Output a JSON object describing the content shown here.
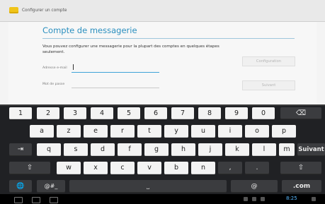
{
  "appbar": {
    "title": "Configurer un compte"
  },
  "page": {
    "title": "Compte de messagerie",
    "description": "Vous pouvez configurer une messagerie pour la plupart des comptes en quelques étapes seulement.",
    "email_label": "Adresse e-mail",
    "password_label": "Mot de passe",
    "config_button": "Configuration",
    "next_button": "Suivant"
  },
  "keyboard": {
    "row1": [
      "1",
      "2",
      "3",
      "4",
      "5",
      "6",
      "7",
      "8",
      "9",
      "0"
    ],
    "row2": [
      "a",
      "z",
      "e",
      "r",
      "t",
      "y",
      "u",
      "i",
      "o",
      "p"
    ],
    "row3": [
      "q",
      "s",
      "d",
      "f",
      "g",
      "h",
      "j",
      "k",
      "l",
      "m"
    ],
    "row4": [
      "w",
      "x",
      "c",
      "v",
      "b",
      "n",
      ",",
      "."
    ],
    "keys": {
      "backspace": "⌫",
      "tab": "⇥",
      "enter": "Suivant",
      "shift": "⇧",
      "globe": "🌐",
      "symbols": "@#_",
      "space": "⎵",
      "at": "@",
      "dotcom": ".com"
    }
  },
  "statusbar": {
    "time": "8:25"
  },
  "colors": {
    "accent": "#2b8fbf",
    "input_focus": "#3ea3d8",
    "keyboard_bg": "#202124",
    "key_bg": "#f3f3f3"
  }
}
